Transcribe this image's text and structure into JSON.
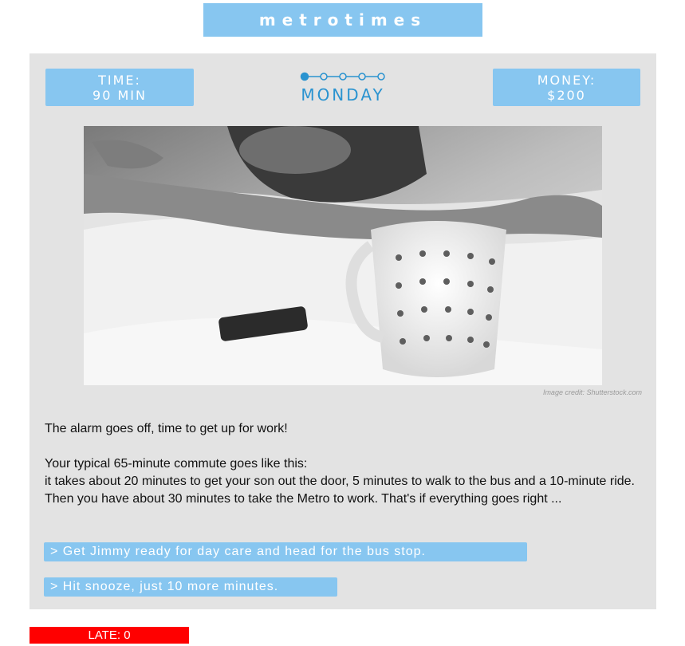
{
  "header": {
    "logo_text": "metrotimes"
  },
  "stats": {
    "time_label": "TIME:",
    "time_value": "90 MIN",
    "money_label": "MONEY:",
    "money_value": "$200"
  },
  "day": {
    "name": "MONDAY",
    "progress_current": 1,
    "progress_total": 5
  },
  "image": {
    "credit": "Image credit: Shutterstock.com"
  },
  "story": {
    "line1": "The alarm goes off, time to get up for work!",
    "line2": "Your typical 65-minute commute goes like this:",
    "line3": "it takes about 20 minutes to get your son out the door, 5 minutes to walk to the bus and a 10-minute ride. Then you have about 30 minutes to take the Metro to work. That's if everything goes right ..."
  },
  "choices": [
    {
      "label": "> Get Jimmy ready for day care and head for the bus stop."
    },
    {
      "label": "> Hit snooze, just 10 more minutes."
    }
  ],
  "status": {
    "late_label": "LATE: 0"
  },
  "colors": {
    "accent": "#87c6f0",
    "day_blue": "#2a93d0",
    "panel": "#e3e3e3",
    "late_red": "#ff0000"
  }
}
